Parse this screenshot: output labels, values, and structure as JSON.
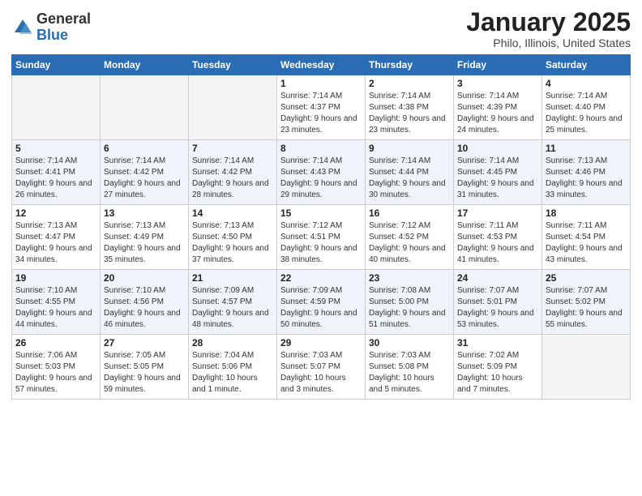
{
  "logo": {
    "general": "General",
    "blue": "Blue"
  },
  "header": {
    "title": "January 2025",
    "subtitle": "Philo, Illinois, United States"
  },
  "days_of_week": [
    "Sunday",
    "Monday",
    "Tuesday",
    "Wednesday",
    "Thursday",
    "Friday",
    "Saturday"
  ],
  "weeks": [
    {
      "days": [
        {
          "number": "",
          "info": ""
        },
        {
          "number": "",
          "info": ""
        },
        {
          "number": "",
          "info": ""
        },
        {
          "number": "1",
          "info": "Sunrise: 7:14 AM\nSunset: 4:37 PM\nDaylight: 9 hours and 23 minutes."
        },
        {
          "number": "2",
          "info": "Sunrise: 7:14 AM\nSunset: 4:38 PM\nDaylight: 9 hours and 23 minutes."
        },
        {
          "number": "3",
          "info": "Sunrise: 7:14 AM\nSunset: 4:39 PM\nDaylight: 9 hours and 24 minutes."
        },
        {
          "number": "4",
          "info": "Sunrise: 7:14 AM\nSunset: 4:40 PM\nDaylight: 9 hours and 25 minutes."
        }
      ]
    },
    {
      "days": [
        {
          "number": "5",
          "info": "Sunrise: 7:14 AM\nSunset: 4:41 PM\nDaylight: 9 hours and 26 minutes."
        },
        {
          "number": "6",
          "info": "Sunrise: 7:14 AM\nSunset: 4:42 PM\nDaylight: 9 hours and 27 minutes."
        },
        {
          "number": "7",
          "info": "Sunrise: 7:14 AM\nSunset: 4:42 PM\nDaylight: 9 hours and 28 minutes."
        },
        {
          "number": "8",
          "info": "Sunrise: 7:14 AM\nSunset: 4:43 PM\nDaylight: 9 hours and 29 minutes."
        },
        {
          "number": "9",
          "info": "Sunrise: 7:14 AM\nSunset: 4:44 PM\nDaylight: 9 hours and 30 minutes."
        },
        {
          "number": "10",
          "info": "Sunrise: 7:14 AM\nSunset: 4:45 PM\nDaylight: 9 hours and 31 minutes."
        },
        {
          "number": "11",
          "info": "Sunrise: 7:13 AM\nSunset: 4:46 PM\nDaylight: 9 hours and 33 minutes."
        }
      ]
    },
    {
      "days": [
        {
          "number": "12",
          "info": "Sunrise: 7:13 AM\nSunset: 4:47 PM\nDaylight: 9 hours and 34 minutes."
        },
        {
          "number": "13",
          "info": "Sunrise: 7:13 AM\nSunset: 4:49 PM\nDaylight: 9 hours and 35 minutes."
        },
        {
          "number": "14",
          "info": "Sunrise: 7:13 AM\nSunset: 4:50 PM\nDaylight: 9 hours and 37 minutes."
        },
        {
          "number": "15",
          "info": "Sunrise: 7:12 AM\nSunset: 4:51 PM\nDaylight: 9 hours and 38 minutes."
        },
        {
          "number": "16",
          "info": "Sunrise: 7:12 AM\nSunset: 4:52 PM\nDaylight: 9 hours and 40 minutes."
        },
        {
          "number": "17",
          "info": "Sunrise: 7:11 AM\nSunset: 4:53 PM\nDaylight: 9 hours and 41 minutes."
        },
        {
          "number": "18",
          "info": "Sunrise: 7:11 AM\nSunset: 4:54 PM\nDaylight: 9 hours and 43 minutes."
        }
      ]
    },
    {
      "days": [
        {
          "number": "19",
          "info": "Sunrise: 7:10 AM\nSunset: 4:55 PM\nDaylight: 9 hours and 44 minutes."
        },
        {
          "number": "20",
          "info": "Sunrise: 7:10 AM\nSunset: 4:56 PM\nDaylight: 9 hours and 46 minutes."
        },
        {
          "number": "21",
          "info": "Sunrise: 7:09 AM\nSunset: 4:57 PM\nDaylight: 9 hours and 48 minutes."
        },
        {
          "number": "22",
          "info": "Sunrise: 7:09 AM\nSunset: 4:59 PM\nDaylight: 9 hours and 50 minutes."
        },
        {
          "number": "23",
          "info": "Sunrise: 7:08 AM\nSunset: 5:00 PM\nDaylight: 9 hours and 51 minutes."
        },
        {
          "number": "24",
          "info": "Sunrise: 7:07 AM\nSunset: 5:01 PM\nDaylight: 9 hours and 53 minutes."
        },
        {
          "number": "25",
          "info": "Sunrise: 7:07 AM\nSunset: 5:02 PM\nDaylight: 9 hours and 55 minutes."
        }
      ]
    },
    {
      "days": [
        {
          "number": "26",
          "info": "Sunrise: 7:06 AM\nSunset: 5:03 PM\nDaylight: 9 hours and 57 minutes."
        },
        {
          "number": "27",
          "info": "Sunrise: 7:05 AM\nSunset: 5:05 PM\nDaylight: 9 hours and 59 minutes."
        },
        {
          "number": "28",
          "info": "Sunrise: 7:04 AM\nSunset: 5:06 PM\nDaylight: 10 hours and 1 minute."
        },
        {
          "number": "29",
          "info": "Sunrise: 7:03 AM\nSunset: 5:07 PM\nDaylight: 10 hours and 3 minutes."
        },
        {
          "number": "30",
          "info": "Sunrise: 7:03 AM\nSunset: 5:08 PM\nDaylight: 10 hours and 5 minutes."
        },
        {
          "number": "31",
          "info": "Sunrise: 7:02 AM\nSunset: 5:09 PM\nDaylight: 10 hours and 7 minutes."
        },
        {
          "number": "",
          "info": ""
        }
      ]
    }
  ]
}
